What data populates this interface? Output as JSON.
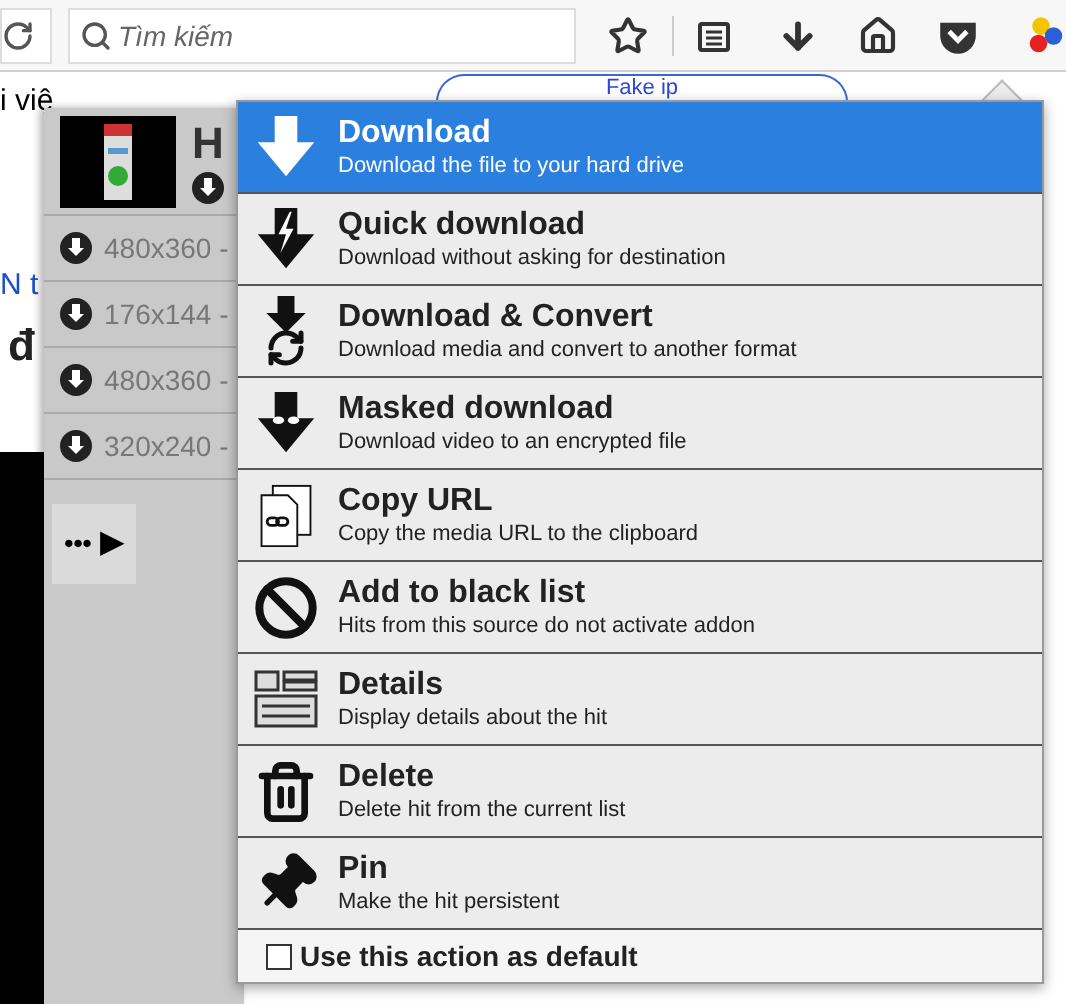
{
  "toolbar": {
    "search": {
      "placeholder": "Tìm kiếm"
    }
  },
  "page": {
    "texts": [
      "i việ",
      "N t",
      "đ"
    ],
    "fake_ip_button": "Fake ip"
  },
  "media_panel": {
    "title": "H",
    "variants": [
      "480x360 -",
      "176x144 -",
      "480x360 -",
      "320x240 -"
    ],
    "more_button": "•••",
    "play_button": "▶"
  },
  "action_menu": {
    "items": [
      {
        "title": "Download",
        "description": "Download the file to your hard drive",
        "selected": true
      },
      {
        "title": "Quick download",
        "description": "Download without asking for destination",
        "selected": false
      },
      {
        "title": "Download & Convert",
        "description": "Download media and convert to another format",
        "selected": false
      },
      {
        "title": "Masked download",
        "description": "Download video to an encrypted file",
        "selected": false
      },
      {
        "title": "Copy URL",
        "description": "Copy the media URL to the clipboard",
        "selected": false
      },
      {
        "title": "Add to black list",
        "description": "Hits from this source do not activate addon",
        "selected": false
      },
      {
        "title": "Details",
        "description": "Display details about the hit",
        "selected": false
      },
      {
        "title": "Delete",
        "description": "Delete hit from the current list",
        "selected": false
      },
      {
        "title": "Pin",
        "description": "Make the hit persistent",
        "selected": false
      }
    ],
    "default_option": {
      "label": "Use this action as default",
      "checked": false
    }
  }
}
